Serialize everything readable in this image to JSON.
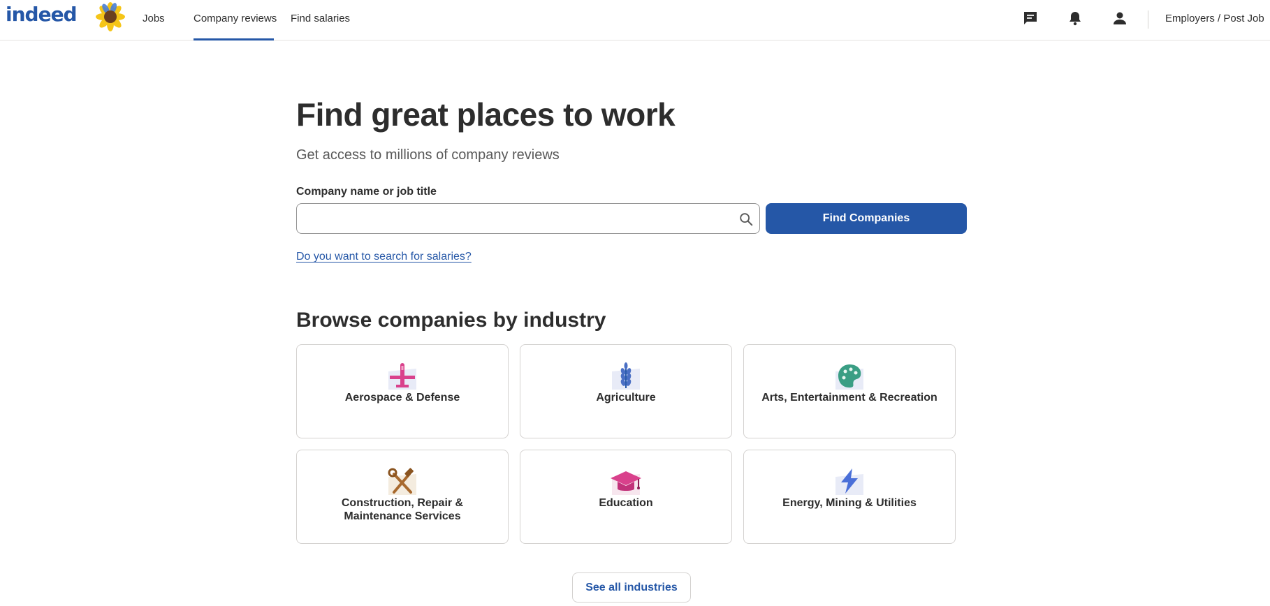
{
  "header": {
    "logo_text": "indeed",
    "nav": [
      {
        "label": "Jobs"
      },
      {
        "label": "Company reviews"
      },
      {
        "label": "Find salaries"
      }
    ],
    "icons": [
      "messages-icon",
      "notifications-icon",
      "account-icon"
    ],
    "employers_label": "Employers / Post Job",
    "brand_color": "#2557a7"
  },
  "hero": {
    "title": "Find great places to work",
    "subtitle": "Get access to millions of company reviews"
  },
  "search": {
    "label": "Company name or job title",
    "value": "",
    "placeholder": "",
    "button_label": "Find Companies",
    "salary_link": "Do you want to search for salaries?"
  },
  "browse": {
    "title": "Browse companies by industry",
    "industries": [
      {
        "label": "Aerospace & Defense",
        "icon": "airplane-icon"
      },
      {
        "label": "Agriculture",
        "icon": "wheat-icon"
      },
      {
        "label": "Arts, Entertainment & Recreation",
        "icon": "palette-icon"
      },
      {
        "label": "Construction, Repair & Maintenance Services",
        "icon": "tools-icon"
      },
      {
        "label": "Education",
        "icon": "graduation-cap-icon"
      },
      {
        "label": "Energy, Mining & Utilities",
        "icon": "lightning-icon"
      }
    ],
    "see_all_label": "See all industries"
  }
}
